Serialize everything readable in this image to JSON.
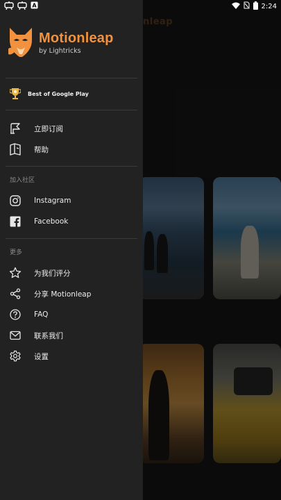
{
  "status_bar": {
    "time": "2:24",
    "left_icons": [
      "notification-icon",
      "notification-icon",
      "a-icon"
    ],
    "right_icons": [
      "wifi-icon",
      "no-sim-icon",
      "battery-icon"
    ]
  },
  "background": {
    "title": "nleap"
  },
  "drawer": {
    "brand_name": "Motionleap",
    "brand_sub": "by Lightricks",
    "badge": {
      "icon": "trophy-icon",
      "label": "Best of Google Play"
    },
    "primary_items": [
      {
        "icon": "subscribe-icon",
        "label": "立即订阅"
      },
      {
        "icon": "help-book-icon",
        "label": "帮助"
      }
    ],
    "community_header": "加入社区",
    "community_items": [
      {
        "icon": "instagram-icon",
        "label": "Instagram"
      },
      {
        "icon": "facebook-icon",
        "label": "Facebook"
      }
    ],
    "more_header": "更多",
    "more_items": [
      {
        "icon": "star-icon",
        "label": "为我们评分"
      },
      {
        "icon": "share-icon",
        "label": "分享 Motionleap"
      },
      {
        "icon": "question-icon",
        "label": "FAQ"
      },
      {
        "icon": "mail-icon",
        "label": "联系我们"
      },
      {
        "icon": "gear-icon",
        "label": "设置"
      }
    ]
  },
  "colors": {
    "accent": "#f2913e",
    "drawer_bg": "#222222",
    "text": "#ececec",
    "section_text": "#8a8a8a"
  }
}
